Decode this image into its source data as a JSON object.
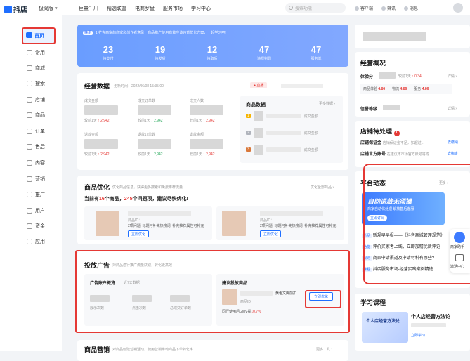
{
  "topbar": {
    "logo": "抖店",
    "edition": "极简版",
    "nav": [
      "巨量千川",
      "精选联盟",
      "电商罗盘",
      "服务市场",
      "学习中心"
    ],
    "search_placeholder": "搜索功能",
    "right": [
      "客户端",
      "辣讯",
      "消息"
    ]
  },
  "sidebar": {
    "items": [
      "首页",
      "常用",
      "商城",
      "搜索",
      "店铺",
      "商品",
      "订单",
      "售后",
      "内容",
      "营销",
      "推广",
      "用户",
      "资金",
      "应用"
    ]
  },
  "banner": {
    "tag": "快讯",
    "note": "1 扩充商家的商家和创作者意见，商品推广使用有效应该违背优化方案，一起学习吧!",
    "stats": [
      {
        "value": "23",
        "label": "待支付"
      },
      {
        "value": "19",
        "label": "待发货"
      },
      {
        "value": "12",
        "label": "待取后"
      },
      {
        "value": "47",
        "label": "违规判罚"
      },
      {
        "value": "47",
        "label": "服务单"
      }
    ]
  },
  "business": {
    "title": "经营数据",
    "update": "更新时间：2022/06/08 15:35:00",
    "live_tag": "直播",
    "metrics": [
      {
        "label": "成交金额",
        "cmp": "较前1天",
        "delta": "2,942",
        "dir": "up"
      },
      {
        "label": "成交订单数",
        "cmp": "较前1天",
        "delta": "2,942",
        "dir": "down"
      },
      {
        "label": "成交人数",
        "cmp": "较前1天",
        "delta": "2,942",
        "dir": "up"
      },
      {
        "label": "退款金额",
        "cmp": "较前1天",
        "delta": "2,942",
        "dir": "up"
      },
      {
        "label": "退款订单数",
        "cmp": "较前1天",
        "delta": "2,942",
        "dir": "down"
      },
      {
        "label": "退款金额",
        "cmp": "较前1天",
        "delta": "2,942",
        "dir": "up"
      }
    ],
    "product_title": "商品数据",
    "product_more": "更多数据",
    "product_ranks": [
      "1",
      "2",
      "3"
    ],
    "product_label": "成交金额"
  },
  "optimize": {
    "title": "商品优化",
    "desc": "优化商品信息，获得更多搜索和免费推荐流量",
    "more": "优化全部商品",
    "headline_pre": "当前有",
    "count1": "16",
    "headline_mid": "个商品，",
    "count2": "245",
    "headline_post": "个问题项，建议尽快优化!",
    "items": [
      {
        "id_label": "商品ID：",
        "issues": "2项问题",
        "t1": "标题可补充热搜词",
        "t2": "补充推荐属性可补充",
        "btn": "立即优化"
      },
      {
        "id_label": "商品ID：",
        "issues": "2项问题",
        "t1": "标题可补充热搜词",
        "t2": "补充推荐属性可补充",
        "btn": "立即优化"
      }
    ]
  },
  "ads": {
    "title": "投放广告",
    "desc": "对商品进行推广流量获取，转化更高效",
    "account_title": "广告账户概览",
    "account_sub": "近7天数据",
    "metrics": [
      "展示次数",
      "点击次数",
      "总成交订单数"
    ],
    "suggest_title": "建议投放商品",
    "product_name": "黄色文胸前扣",
    "product_id": "商品ID",
    "peer": "同行使用后GMV提",
    "peer_pct": "10.7%",
    "btn": "立即优化"
  },
  "marketing": {
    "title": "商品营销",
    "desc": "对商品创建营销活动，使用营销推动商品下单转化率",
    "more": "更多工具"
  },
  "right": {
    "overview_title": "经营概况",
    "score_label": "体验分",
    "score_cmp": "较前1天",
    "score_delta": "0.34",
    "sub_scores": [
      {
        "label": "商品体验",
        "value": "4.86"
      },
      {
        "label": "物流",
        "value": "4.86"
      },
      {
        "label": "服务",
        "value": "4.86"
      }
    ],
    "credit_label": "信誉等级",
    "detail": "详情",
    "shop_title": "店铺待处理",
    "shop_badge": "1",
    "shop_items": [
      {
        "label": "店铺保证金",
        "desc": "店铺保证金不足，如超过...",
        "action": "去缴纳"
      },
      {
        "label": "店铺官方账号",
        "desc": "在建议本市场官方账号将成...",
        "action": "去绑定"
      }
    ],
    "news_title": "平台动态",
    "news_more": "更多",
    "banner_title": "自助退款无须操",
    "banner_sub": "商家自动化处理 解放售后客服",
    "banner_btn": "立即订阅",
    "news": [
      {
        "tag": "新品",
        "text": "新规早早报——《抖音商城管理规范》"
      },
      {
        "tag": "功能",
        "text": "评价买家考上线，立即加精优质评论"
      },
      {
        "tag": "规则",
        "text": "商家申请渠道及申请材料有哪些?"
      },
      {
        "tag": "课程",
        "text": "抖店服务市场-经营实践案例精选"
      }
    ],
    "learn_title": "学习课程",
    "course_title": "个人店经营方法论",
    "course_thumb": "个人店经营方法论",
    "course_link": "立即学习",
    "assistant": "商家助手",
    "feedback": "激活中心"
  },
  "colors": {
    "accent": "#1f6fff",
    "highlight": "#e53935",
    "up": "#e53935",
    "down": "#29a95d"
  }
}
